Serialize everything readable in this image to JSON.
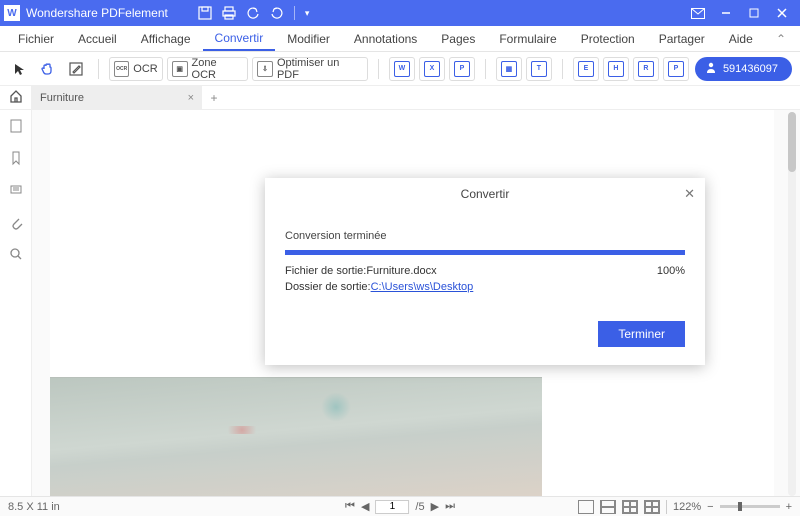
{
  "app": {
    "title": "Wondershare PDFelement"
  },
  "menu": {
    "items": [
      "Fichier",
      "Accueil",
      "Affichage",
      "Convertir",
      "Modifier",
      "Annotations",
      "Pages",
      "Formulaire",
      "Protection",
      "Partager",
      "Aide"
    ],
    "active_index": 3
  },
  "ribbon": {
    "ocr_label": "OCR",
    "zone_ocr_label": "Zone OCR",
    "optimize_label": "Optimiser un PDF",
    "user_id": "591436097"
  },
  "tabs": {
    "doc_name": "Furniture"
  },
  "dialog": {
    "title": "Convertir",
    "status": "Conversion terminée",
    "file_label": "Fichier de sortie: ",
    "file_value": "Furniture.docx",
    "percent": "100%",
    "folder_label": "Dossier de sortie: ",
    "folder_link": "C:\\Users\\ws\\Desktop",
    "finish_label": "Terminer"
  },
  "statusbar": {
    "dimensions": "8.5 X 11 in",
    "page_current": "1",
    "page_sep": "/",
    "page_total": "5",
    "zoom_value": "122%"
  }
}
